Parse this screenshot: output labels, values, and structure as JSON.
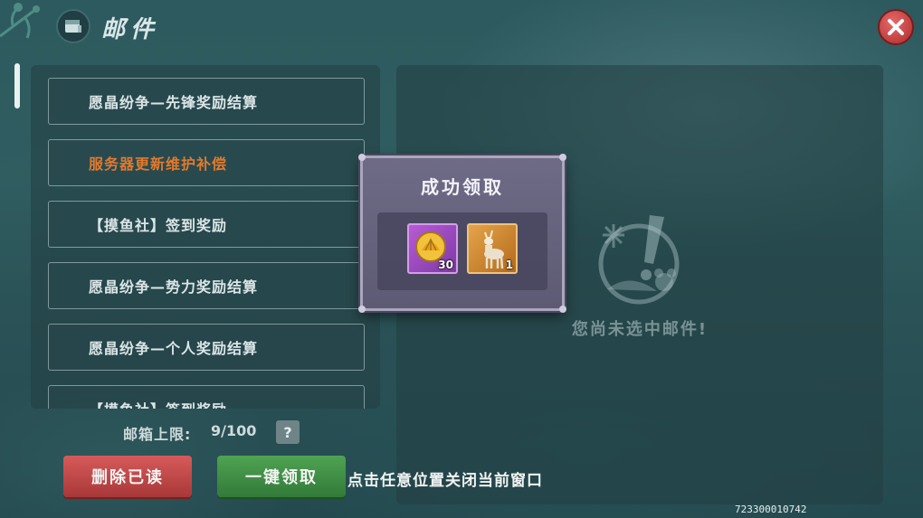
{
  "header": {
    "title": "邮件"
  },
  "mail_list": [
    {
      "subject": "愿晶纷争—先锋奖励结算",
      "unread": false
    },
    {
      "subject": "服务器更新维护补偿",
      "unread": true
    },
    {
      "subject": "【摸鱼社】签到奖励",
      "unread": false
    },
    {
      "subject": "愿晶纷争—势力奖励结算",
      "unread": false
    },
    {
      "subject": "愿晶纷争—个人奖励结算",
      "unread": false
    },
    {
      "subject": "【摸鱼社】签到奖励",
      "unread": false
    }
  ],
  "detail": {
    "empty_text": "您尚未选中邮件!"
  },
  "mailbox": {
    "limit_label": "邮箱上限:",
    "limit_value": "9/100",
    "help_label": "?"
  },
  "buttons": {
    "delete_read": "删除已读",
    "claim_all": "一键领取"
  },
  "hint": "点击任意位置关闭当前窗口",
  "user_id": "723300010742",
  "popup": {
    "title": "成功领取",
    "rewards": [
      {
        "icon": "gold-shell-coin-icon",
        "count": "30"
      },
      {
        "icon": "deer-mount-icon",
        "count": "1"
      }
    ]
  },
  "colors": {
    "unread_subject": "#e07a2e",
    "delete_button": "#c04848",
    "claim_button": "#3f8f45",
    "close_button": "#c03434"
  }
}
